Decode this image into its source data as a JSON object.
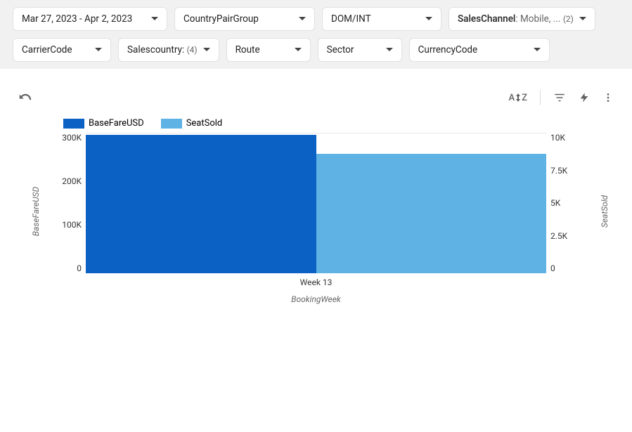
{
  "filters": {
    "dateRange": "Mar 27, 2023 - Apr 2, 2023",
    "countryPairGroup": "CountryPairGroup",
    "domInt": "DOM/INT",
    "salesChannelLabel": "SalesChannel",
    "salesChannelValue": ": Mobile, ...",
    "salesChannelCount": "(2)",
    "carrierCode": "CarrierCode",
    "salesCountryLabel": "Salescountry:",
    "salesCountryCount": "(4)",
    "route": "Route",
    "sector": "Sector",
    "currencyCode": "CurrencyCode"
  },
  "chart": {
    "legend": {
      "series1": "BaseFareUSD",
      "series2": "SeatSold"
    },
    "yLeftTicks": [
      "300K",
      "200K",
      "100K",
      "0"
    ],
    "yRightTicks": [
      "10K",
      "7.5K",
      "5K",
      "2.5K",
      "0"
    ],
    "yLeftLabel": "BaseFareUSD",
    "yRightLabel": "SeatSold",
    "xLabel": "BookingWeek",
    "xTick": "Week 13",
    "colors": {
      "series1": "#0b62c4",
      "series2": "#5eb3e4"
    }
  },
  "chart_data": {
    "type": "bar",
    "categories": [
      "Week 13"
    ],
    "series": [
      {
        "name": "BaseFareUSD",
        "values": [
          295000
        ],
        "axis": "left"
      },
      {
        "name": "SeatSold",
        "values": [
          8500
        ],
        "axis": "right"
      }
    ],
    "xlabel": "BookingWeek",
    "ylabel_left": "BaseFareUSD",
    "ylabel_right": "SeatSold",
    "ylim_left": [
      0,
      300000
    ],
    "ylim_right": [
      0,
      10000
    ],
    "legend_position": "top-left",
    "grid": true
  }
}
